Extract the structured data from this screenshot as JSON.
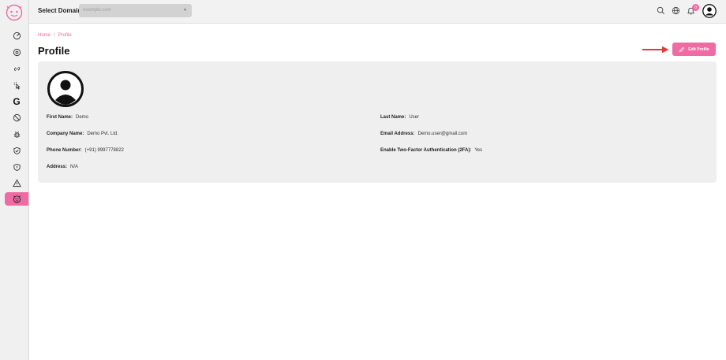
{
  "header": {
    "domain_label": "Select Domain",
    "domain_placeholder": "example.com",
    "notification_count": "0"
  },
  "sidebar": {
    "items": [
      {
        "icon": "dashboard-icon"
      },
      {
        "icon": "settings-gear-icon"
      },
      {
        "icon": "link-icon"
      },
      {
        "icon": "pointer-click-icon"
      },
      {
        "icon": "google-g-icon",
        "label": "G"
      },
      {
        "icon": "block-icon"
      },
      {
        "icon": "bug-icon"
      },
      {
        "icon": "shield-check-icon"
      },
      {
        "icon": "shield-alert-icon"
      },
      {
        "icon": "warning-triangle-icon"
      },
      {
        "icon": "profile-face-icon",
        "active": true
      }
    ]
  },
  "breadcrumb": {
    "home": "Home",
    "separator": "/",
    "current": "Profile"
  },
  "page": {
    "title": "Profile",
    "edit_button": "Edit Profile"
  },
  "profile": {
    "first_name_label": "First Name:",
    "first_name": "Demo",
    "last_name_label": "Last Name:",
    "last_name": "User",
    "company_label": "Company Name:",
    "company": "Demo Pvt. Ltd.",
    "email_label": "Email Address:",
    "email": "Demo.user@gmail.com",
    "phone_label": "Phone Number:",
    "phone": "(+91) 9997778822",
    "twofa_label": "Enable Two-Factor Authentication (2FA):",
    "twofa": "Yes",
    "address_label": "Address:",
    "address": "N/A"
  },
  "colors": {
    "accent": "#f06ba3",
    "arrow": "#e53935",
    "sidebar_bg": "#f0f0f0",
    "card_bg": "#efefef"
  }
}
